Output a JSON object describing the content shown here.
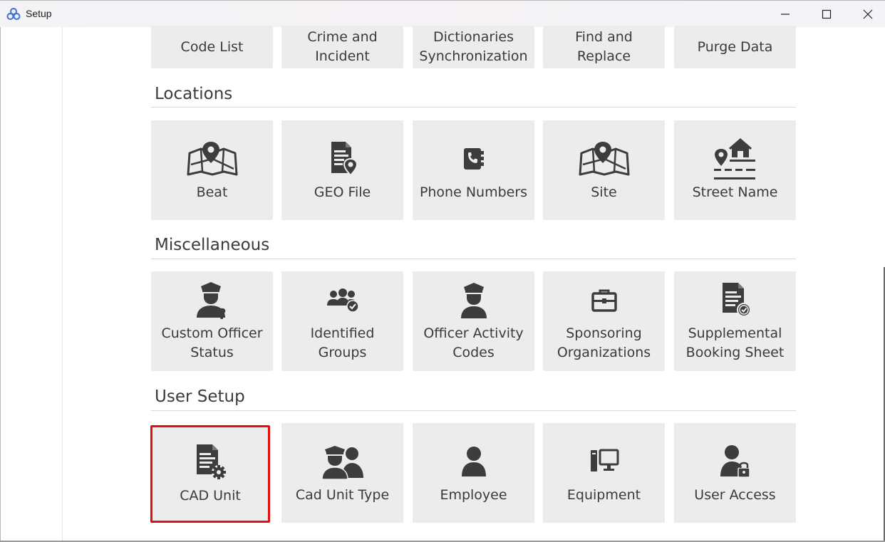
{
  "window": {
    "title": "Setup",
    "minimize_label": "minimize",
    "maximize_label": "maximize",
    "close_label": "close"
  },
  "top_row": [
    {
      "label": "Code List"
    },
    {
      "label": "Crime and\nIncident"
    },
    {
      "label": "Dictionaries\nSynchronization"
    },
    {
      "label": "Find and\nReplace"
    },
    {
      "label": "Purge Data"
    }
  ],
  "sections": {
    "locations": {
      "title": "Locations",
      "items": [
        {
          "label": "Beat",
          "icon": "map-pin-icon"
        },
        {
          "label": "GEO File",
          "icon": "geo-file-icon"
        },
        {
          "label": "Phone Numbers",
          "icon": "phone-book-icon"
        },
        {
          "label": "Site",
          "icon": "map-pin-icon"
        },
        {
          "label": "Street Name",
          "icon": "street-house-icon"
        }
      ]
    },
    "miscellaneous": {
      "title": "Miscellaneous",
      "items": [
        {
          "label": "Custom Officer\nStatus",
          "icon": "officer-question-icon"
        },
        {
          "label": "Identified\nGroups",
          "icon": "group-check-icon"
        },
        {
          "label": "Officer Activity\nCodes",
          "icon": "officer-icon"
        },
        {
          "label": "Sponsoring\nOrganizations",
          "icon": "briefcase-icon"
        },
        {
          "label": "Supplemental\nBooking Sheet",
          "icon": "document-check-icon"
        }
      ]
    },
    "user_setup": {
      "title": "User Setup",
      "items": [
        {
          "label": "CAD Unit",
          "icon": "document-gear-icon",
          "selected": true
        },
        {
          "label": "Cad Unit Type",
          "icon": "officer-pair-icon"
        },
        {
          "label": "Employee",
          "icon": "user-icon"
        },
        {
          "label": "Equipment",
          "icon": "computer-icon"
        },
        {
          "label": "User Access",
          "icon": "user-lock-icon"
        }
      ]
    }
  },
  "colors": {
    "tile_bg": "#ececec",
    "icon": "#3d3d3d",
    "selection_border": "#e01010"
  }
}
